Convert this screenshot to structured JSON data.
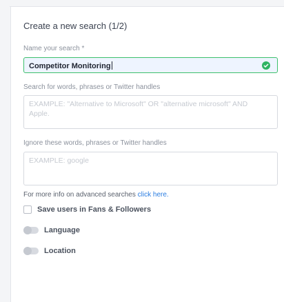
{
  "form": {
    "title": "Create a new search (1/2)",
    "name_label": "Name your search *",
    "name_value": "Competitor Monitoring",
    "words_label": "Search for words, phrases or Twitter handles",
    "words_placeholder": "EXAMPLE: \"Alternative to Microsoft\" OR \"alternative microsoft\" AND Apple.",
    "ignore_label": "Ignore these words, phrases or Twitter handles",
    "ignore_placeholder": "EXAMPLE: google",
    "info_text": "For more info on advanced searches ",
    "info_link": "click here.",
    "save_users_label": "Save users in Fans & Followers",
    "language_label": "Language",
    "location_label": "Location"
  },
  "colors": {
    "accent_green": "#3cbf6c",
    "link_blue": "#2a7de1"
  }
}
